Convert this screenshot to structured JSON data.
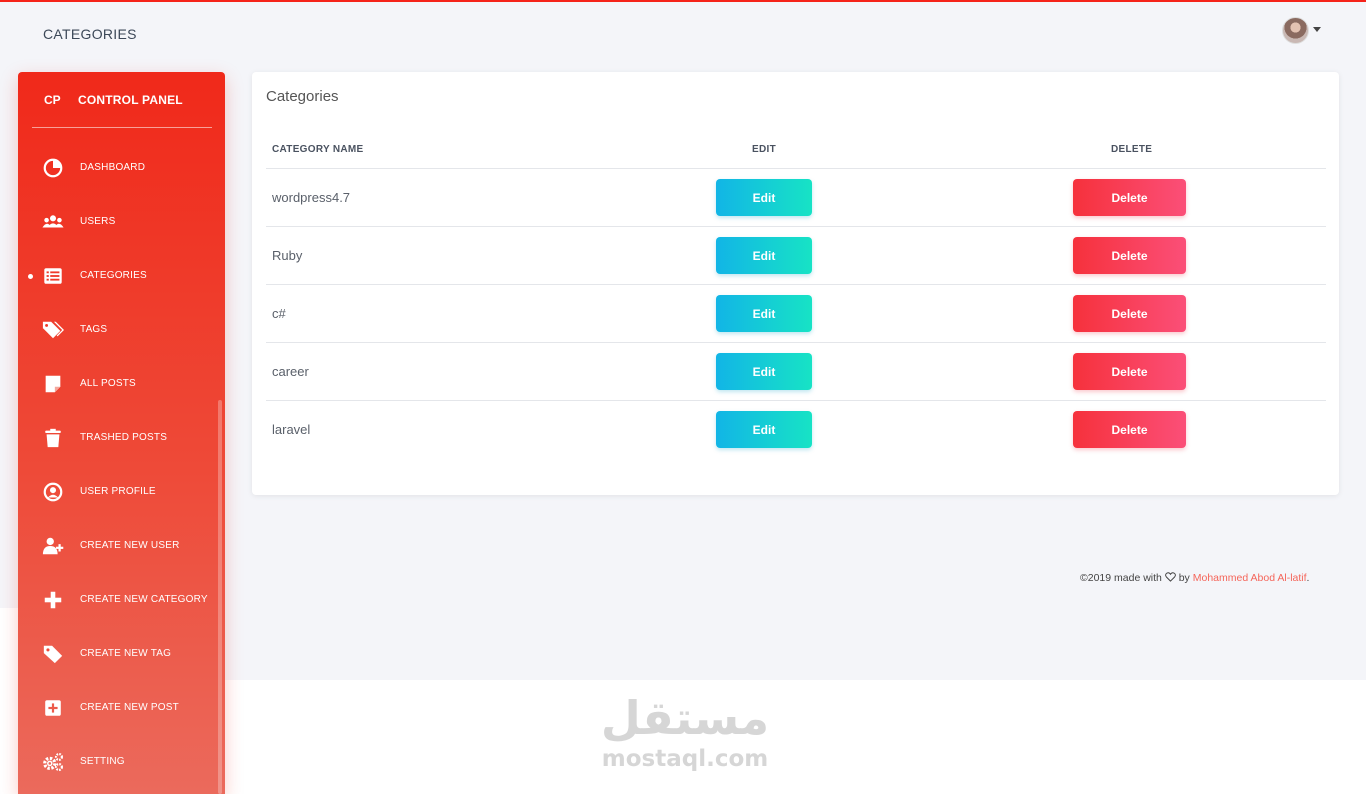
{
  "colors": {
    "accent": "#f0291a",
    "edit_button": "#12b5e6",
    "delete_button": "#f6313c",
    "page_background": "#f4f5f9"
  },
  "navbar": {
    "title": "CATEGORIES",
    "avatar_icon": "user-avatar",
    "caret_icon": "caret-down-icon"
  },
  "sidebar": {
    "brand_short": "CP",
    "brand_name": "CONTROL PANEL",
    "active_item": "CATEGORIES",
    "items": [
      {
        "label": "DASHBOARD",
        "icon": "pie-chart-icon"
      },
      {
        "label": "USERS",
        "icon": "users-icon"
      },
      {
        "label": "CATEGORIES",
        "icon": "list-icon"
      },
      {
        "label": "TAGS",
        "icon": "tags-icon"
      },
      {
        "label": "ALL POSTS",
        "icon": "note-icon"
      },
      {
        "label": "TRASHED POSTS",
        "icon": "trash-icon"
      },
      {
        "label": "USER PROFILE",
        "icon": "user-circle-icon"
      },
      {
        "label": "CREATE NEW USER",
        "icon": "user-plus-icon"
      },
      {
        "label": "CREATE NEW CATEGORY",
        "icon": "plus-icon"
      },
      {
        "label": "CREATE NEW TAG",
        "icon": "tag-icon"
      },
      {
        "label": "CREATE NEW POST",
        "icon": "plus-square-icon"
      },
      {
        "label": "SETTING",
        "icon": "cogs-icon"
      }
    ]
  },
  "card": {
    "title": "Categories",
    "columns": [
      "CATEGORY NAME",
      "EDIT",
      "DELETE"
    ],
    "rows": [
      {
        "name": "wordpress4.7",
        "edit": "Edit",
        "delete": "Delete"
      },
      {
        "name": "Ruby",
        "edit": "Edit",
        "delete": "Delete"
      },
      {
        "name": "c#",
        "edit": "Edit",
        "delete": "Delete"
      },
      {
        "name": "career",
        "edit": "Edit",
        "delete": "Delete"
      },
      {
        "name": "laravel",
        "edit": "Edit",
        "delete": "Delete"
      }
    ]
  },
  "footer": {
    "prefix": "©2019 made with",
    "by": "by",
    "author": "Mohammed Abod Al-latif",
    "suffix": "."
  },
  "watermark": {
    "arabic": "مستقل",
    "latin": "mostaql.com"
  }
}
